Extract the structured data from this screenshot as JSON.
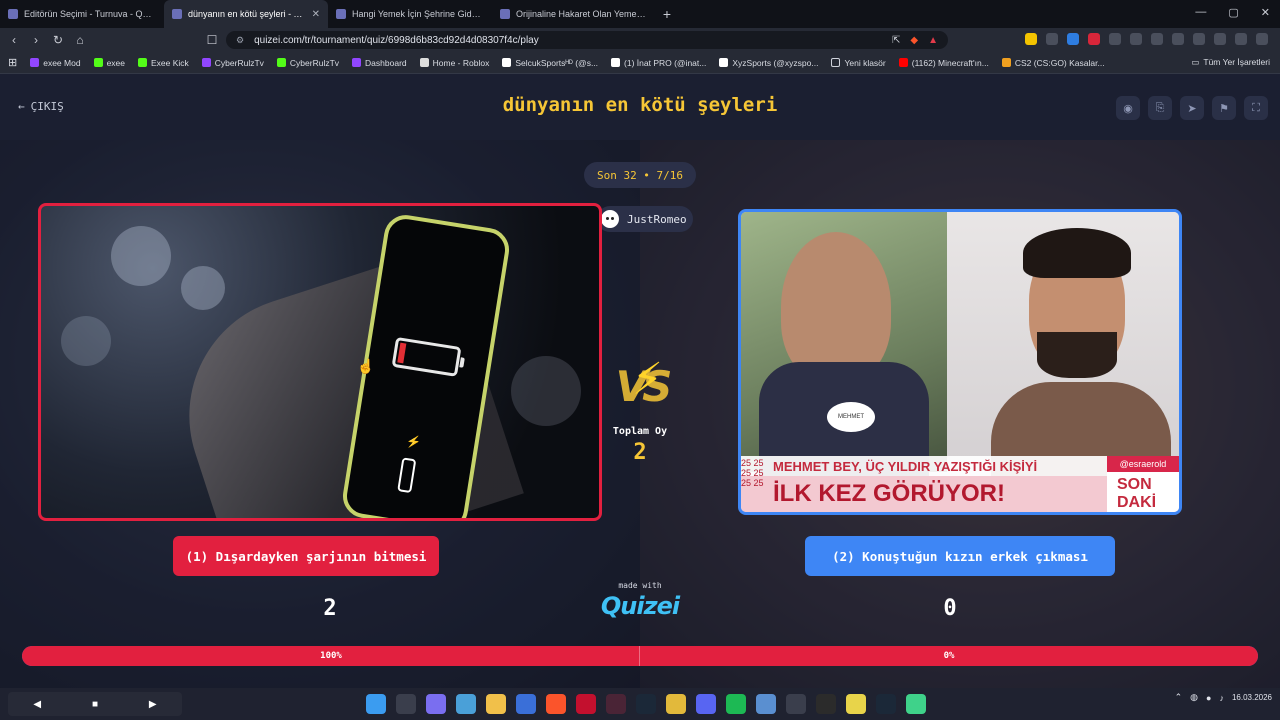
{
  "browser": {
    "tabs": [
      {
        "title": "Editörün Seçimi - Turnuva - Quizei",
        "active": false
      },
      {
        "title": "dünyanın en kötü şeyleri - Tier Li",
        "active": true
      },
      {
        "title": "Hangi Yemek İçin Şehrine Gidersin? -",
        "active": false
      },
      {
        "title": "Orijinaline Hakaret Olan Yemek - Tie",
        "active": false
      }
    ],
    "url": "quizei.com/tr/tournament/quiz/6998d6b83cd92d4d08307f4c/play",
    "bookmarks": [
      {
        "label": "exee Mod",
        "color": "#9146ff"
      },
      {
        "label": "exee",
        "color": "#53fc18"
      },
      {
        "label": "Exee Kick",
        "color": "#53fc18"
      },
      {
        "label": "CyberRulzTv",
        "color": "#9146ff"
      },
      {
        "label": "CyberRulzTv",
        "color": "#53fc18"
      },
      {
        "label": "Dashboard",
        "color": "#9146ff"
      },
      {
        "label": "Home - Roblox",
        "color": "#dddddd"
      },
      {
        "label": "SelcukSportsᴴᴰ (@s...",
        "color": "#ffffff"
      },
      {
        "label": "(1) İnat PRO (@inat...",
        "color": "#ffffff"
      },
      {
        "label": "XyzSports (@xyzspo...",
        "color": "#ffffff"
      },
      {
        "label": "Yeni klasör",
        "color": "#cfd3dc"
      },
      {
        "label": "(1162) Minecraft'ın...",
        "color": "#ff0000"
      },
      {
        "label": "CS2 (CS:GO) Kasalar...",
        "color": "#f0a020"
      }
    ],
    "all_bookmarks": "Tüm Yer İşaretleri"
  },
  "header": {
    "exit_label": "ÇIKIŞ",
    "title": "dünyanın en kötü şeyleri"
  },
  "round": {
    "label": "Son 32 • 7/16"
  },
  "user": {
    "name": "JustRomeo"
  },
  "vs": {
    "total_label": "Toplam Oy",
    "total_value": "2"
  },
  "option_left": {
    "label": "(1) Dışardayken şarjının bitmesi",
    "votes": "2",
    "percent_label": "100%",
    "percent": 100
  },
  "option_right": {
    "label": "(2) Konuştuğun kızın erkek çıkması",
    "votes": "0",
    "percent_label": "0%",
    "percent": 0,
    "image_text": {
      "badge": "MEHMET",
      "ticker_top": "MEHMET BEY, ÜÇ YILDIR YAZIŞTIĞI KİŞİYİ",
      "ticker_main": "İLK KEZ GÖRÜYOR!",
      "ticker_left": "25 25 25 25 25 25",
      "handle": "@esraerold",
      "corner": "SON DAKİ"
    }
  },
  "branding": {
    "made_with": "made with",
    "logo": "Quizei"
  },
  "taskbar": {
    "date": "16.03.2026"
  },
  "colors": {
    "accent": "#f6c636",
    "left": "#e2203f",
    "right": "#3e86f5"
  }
}
